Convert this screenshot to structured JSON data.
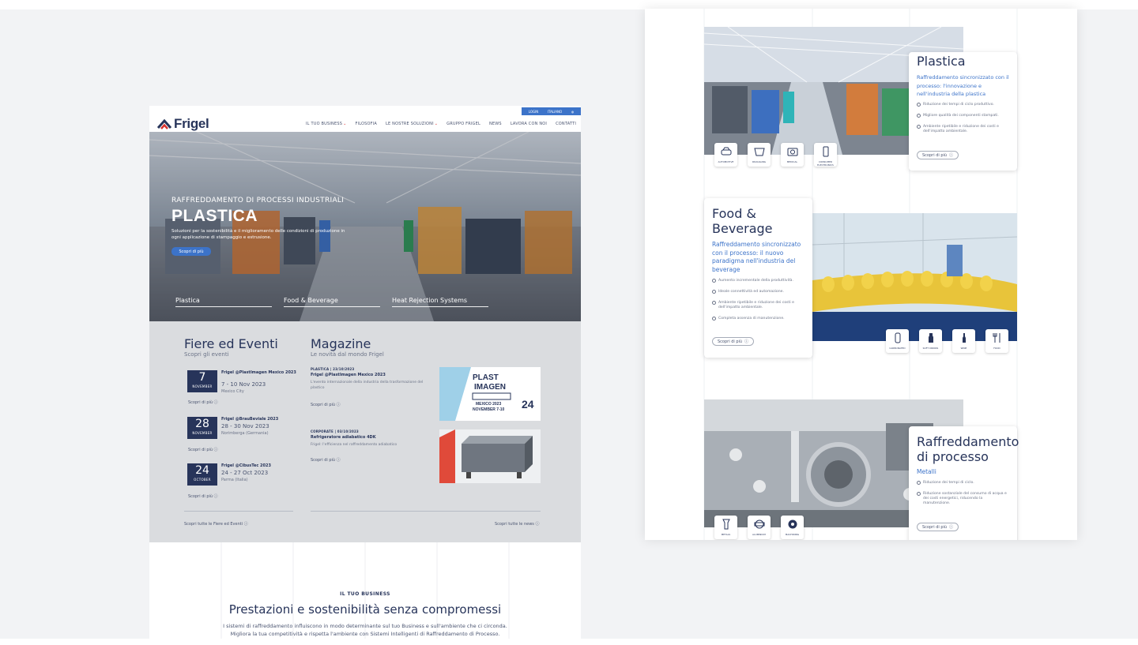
{
  "left_site": {
    "login": {
      "label": "LOGIN",
      "lang": "ITALIANO"
    },
    "logo": "Frigel",
    "nav": [
      {
        "label": "IL TUO BUSINESS",
        "chevron": true
      },
      {
        "label": "FILOSOFIA",
        "chevron": false
      },
      {
        "label": "LE NOSTRE SOLUZIONI",
        "chevron": true
      },
      {
        "label": "GRUPPO FRIGEL",
        "chevron": false
      },
      {
        "label": "NEWS",
        "chevron": false
      },
      {
        "label": "LAVORA CON NOI",
        "chevron": false
      },
      {
        "label": "CONTATTI",
        "chevron": false
      }
    ],
    "hero": {
      "subtitle": "RAFFREDDAMENTO DI PROCESSI INDUSTRIALI",
      "title": "PLASTICA",
      "description": "Soluzioni per la sostenibilità e il miglioramento delle condizioni di produzione in ogni applicazione di stampaggio e estrusione.",
      "button": "Scopri di più",
      "tabs": [
        "Plastica",
        "Food & Beverage",
        "Heat Rejection Systems"
      ]
    },
    "events": {
      "title": "Fiere ed Eventi",
      "subtitle": "Scopri gli eventi",
      "items": [
        {
          "day": "7",
          "month": "NOVEMBER",
          "name": "Frigel @PlastImagen Mexico 2023",
          "dates": "7 - 10 Nov 2023",
          "place": "Mexico City",
          "link": "Scopri di più"
        },
        {
          "day": "28",
          "month": "NOVEMBER",
          "name": "Frigel @BrauBeviale 2023",
          "dates": "28 - 30 Nov 2023",
          "place": "Norimberga (Germania)",
          "link": "Scopri di più"
        },
        {
          "day": "24",
          "month": "OCTOBER",
          "name": "Frigel @CibusTec 2023",
          "dates": "24 - 27 Oct 2023",
          "place": "Parma (Italia)",
          "link": "Scopri di più"
        }
      ],
      "all_link": "Scopri tutte le Fiere ed Eventi"
    },
    "magazine": {
      "title": "Magazine",
      "subtitle": "Le novità dal mondo Frigel",
      "items": [
        {
          "tag": "PLASTICA | 23/10/2023",
          "name": "Frigel @PlastImagen Mexico 2023",
          "desc": "L'evento internazionale della industria della trasformazione del plastico",
          "link": "Scopri di più"
        },
        {
          "tag": "CORPORATE | 03/10/2023",
          "name": "Refrigeratore adiabatico 4DK",
          "desc": "Frigel: l'efficienza nel raffreddamento adiabatico",
          "link": "Scopri di più"
        }
      ],
      "image_text": {
        "l1": "PLAST",
        "l2": "IMAGEN",
        "l3": "MEXICO 2023",
        "l4": "NOVEMBER 7-10",
        "l5": "24"
      },
      "all_link": "Scopri tutte le news"
    },
    "business": {
      "kicker": "IL TUO BUSINESS",
      "title": "Prestazioni e sostenibilità senza compromessi",
      "desc": "I sistemi di raffreddamento influiscono in modo determinante sul tuo Business e sull'ambiente che ci circonda. Migliora la tua competitività e rispetta l'ambiente con Sistemi Intelligenti di Raffreddamento di Processo."
    }
  },
  "right_site": {
    "cards": [
      {
        "title": "Plastica",
        "desc": "Raffreddamento sincronizzato con il processo: l'innovazione e nell'industria della plastica",
        "bullets": [
          "Riduzione dei tempi di ciclo produttivo.",
          "Migliore qualità dei componenti stampati.",
          "Ambiente ripetibile e riduzione dei costi e dell'impatto ambientale."
        ],
        "button": "Scopri di più",
        "icons": [
          "AUTOMOTIVE",
          "PACKAGING",
          "MEDICAL",
          "CONSUMER ELECTRONICS"
        ]
      },
      {
        "title": "Food & Beverage",
        "desc": "Raffreddamento sincronizzato con il processo: il nuovo paradigma nell'industria del beverage",
        "bullets": [
          "Aumento incrementale della produttività.",
          "Ideale connettività ed automazione.",
          "Ambiente ripetibile e riduzione dei costi e dell'impatto ambientale.",
          "Completa assenza di manutenzione."
        ],
        "button": "Scopri di più",
        "icons": [
          "CARBONATED",
          "SOFT DRINKS",
          "WINE",
          "FOOD"
        ]
      },
      {
        "title": "Raffreddamento di processo",
        "desc": "Metalli",
        "bullets": [
          "Riduzione dei tempi di ciclo.",
          "Riduzione sostanziale del consumo di acqua e dei costi energetici, riducendo la manutenzione."
        ],
        "button": "Scopri di più",
        "icons": [
          "METALS",
          "ALUMINIUM",
          "MACHINING"
        ]
      }
    ]
  }
}
